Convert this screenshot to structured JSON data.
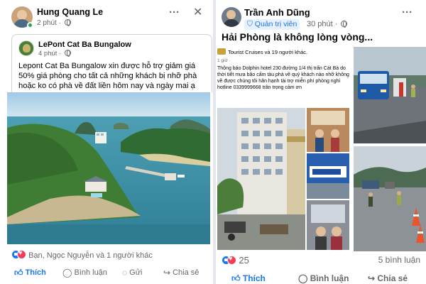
{
  "left_post": {
    "author": "Hung Quang Le",
    "time": "2 phút ·",
    "more_label": "···",
    "close_label": "✕",
    "shared": {
      "page_name": "LePont Cat Ba Bungalow",
      "time": "4 phút ·",
      "text": "Lepont Cat Ba Bungalow xin được hỗ trợ  giảm giá 50% giá phòng cho tất cả những khách bị nhỡ phà hoặc ko có phà về đất liền hôm nay và ngày mai ạ"
    },
    "reactions_text": "Bạn, Ngọc Nguyễn và 1 người khác",
    "actions": {
      "like": "Thích",
      "comment": "Bình luận",
      "send": "Gửi",
      "share": "Chia sẻ"
    }
  },
  "right_post": {
    "author": "Trần Anh Dũng",
    "badge": "Quản trị viên",
    "time": "30 phút ·",
    "more_label": "···",
    "title": "Hải Phòng là không lòng vòng...",
    "embedded": {
      "header": "Tourist Cruises và 19 người khác.",
      "time": "1 giờ ·",
      "text": "Thông báo Dolphin hotel 230 đường 1/4 thị trấn Cát Bà do thời tiết mưa bão cấm tàu phà về quý khách nào nhỡ không về được chúng tôi hân hạnh tài trợ miễn phí phòng nghỉ hotline 0339999668 trân trọng cảm ơn"
    },
    "reaction_count": "25",
    "comment_count": "5 bình luận",
    "actions": {
      "like": "Thích",
      "comment": "Bình luận",
      "share": "Chia sẻ"
    }
  },
  "colors": {
    "facebook_blue": "#1877f2",
    "secondary_text": "#65676b",
    "online_green": "#31a24c"
  }
}
